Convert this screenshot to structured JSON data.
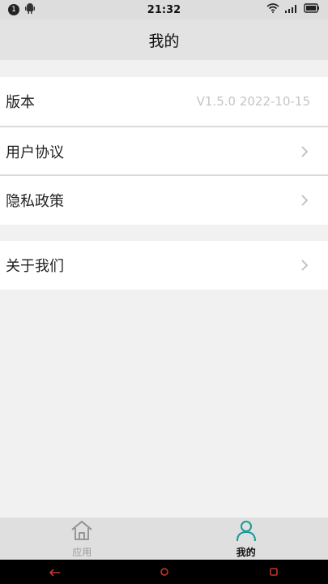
{
  "status_bar": {
    "notification_count": "1",
    "time": "21:32"
  },
  "header": {
    "title": "我的"
  },
  "settings": {
    "version_label": "版本",
    "version_value": "V1.5.0 2022-10-15",
    "user_agreement": "用户协议",
    "privacy_policy": "隐私政策",
    "about_us": "关于我们"
  },
  "tabs": [
    {
      "label": "应用",
      "icon": "home-icon",
      "active": false
    },
    {
      "label": "我的",
      "icon": "user-icon",
      "active": true
    }
  ],
  "colors": {
    "accent": "#1a9a98",
    "inactive": "#9a9a9a",
    "nav_buttons": "#c0392b"
  }
}
